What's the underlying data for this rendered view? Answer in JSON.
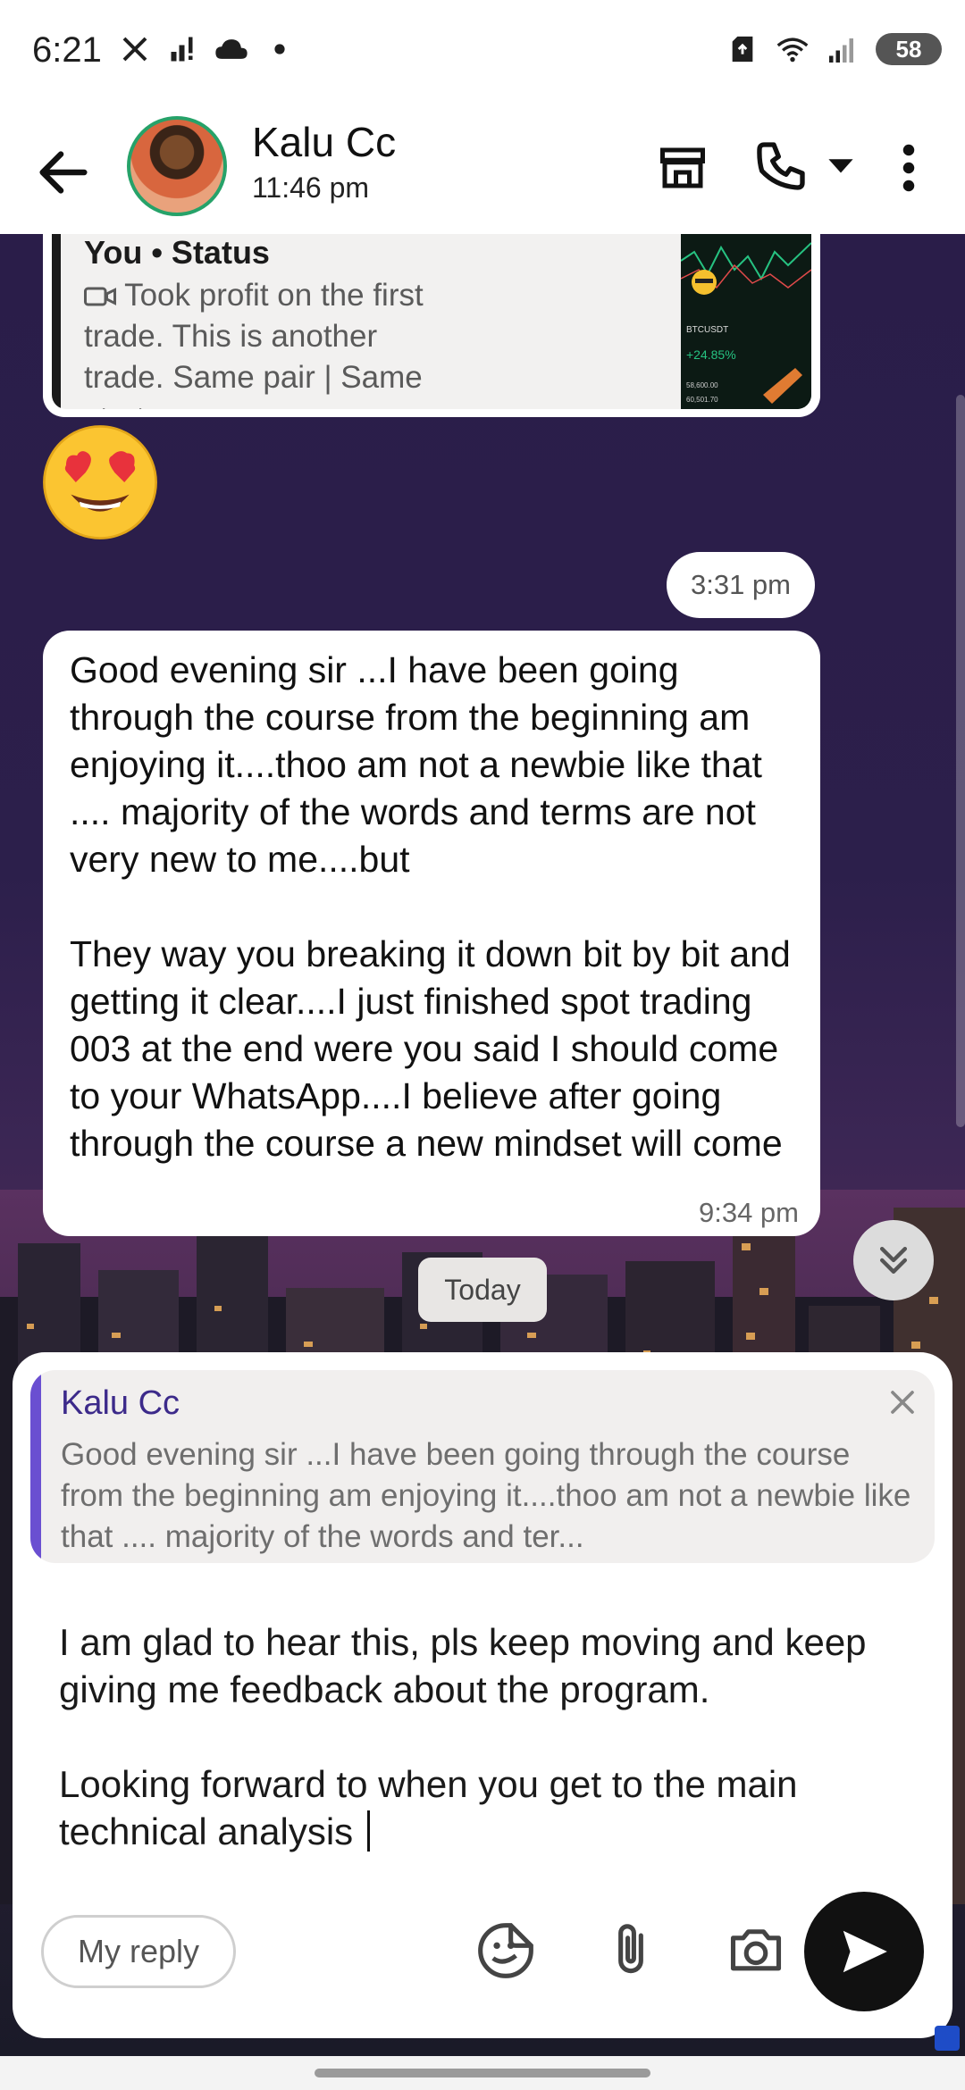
{
  "status_bar": {
    "time": "6:21",
    "battery": "58",
    "left_icons": [
      "x-logo-icon",
      "signal-alert-icon",
      "cloud-icon",
      "dot-icon"
    ],
    "right_icons": [
      "sim-card-icon",
      "wifi-icon",
      "cell-signal-icon",
      "battery-icon"
    ]
  },
  "header": {
    "contact_name": "Kalu Cc",
    "last_seen": "11:46 pm",
    "actions": [
      "back-arrow-icon",
      "store-icon",
      "phone-icon",
      "caret-down-icon",
      "more-vert-icon"
    ]
  },
  "chat": {
    "status_card": {
      "title": "You • Status",
      "text": "Took profit on the first trade. This is another trade. Same pair | Same strategy ...",
      "thumb_pair": "BTCUSDT",
      "thumb_change": "+24.85%",
      "thumb_price1": "58,600.00",
      "thumb_price2": "60,501.70"
    },
    "time_pill": "3:31 pm",
    "message": {
      "text": "Good evening sir ...I have been going through the course from the beginning am enjoying it....thoo am not a newbie like that .... majority of the words and terms are not very new to me....but\n\nThey way you breaking it down bit by bit and getting it clear....I just finished spot trading 003 at the end were you said I should come to your WhatsApp....I believe after going through the course a new mindset will come",
      "time": "9:34 pm"
    },
    "date_chip": "Today"
  },
  "composer": {
    "reply_to_name": "Kalu Cc",
    "reply_to_text": "Good evening sir ...I have been going through the course from the beginning am enjoying it....thoo am not a newbie like that .... majority of the words and ter...",
    "draft_text": "I am glad to hear this, pls keep moving and keep giving me feedback about the program.\n\nLooking forward to when you get to the main technical analysis ",
    "my_reply_label": "My reply",
    "tools": [
      "sticker-icon",
      "attach-icon",
      "camera-icon",
      "send-icon"
    ]
  },
  "colors": {
    "accent_green": "#26a269",
    "reply_accent": "#6a4fd1",
    "send_button": "#111111"
  }
}
